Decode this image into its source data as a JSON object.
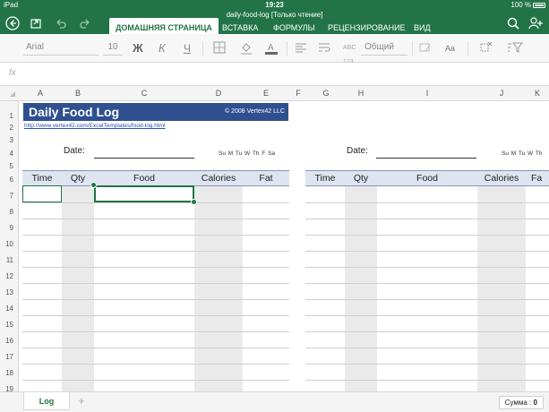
{
  "status": {
    "carrier": "iPad",
    "time": "19:23",
    "battery": "100 %"
  },
  "document": {
    "title": "daily-food-log [Только чтение]"
  },
  "toolbar": {
    "back_icon": "back-circle-icon",
    "share_icon": "share-icon",
    "undo_icon": "undo-icon",
    "redo_icon": "redo-icon",
    "search_icon": "search-icon",
    "user_icon": "add-user-icon"
  },
  "tabs": [
    "ДОМАШНЯЯ СТРАНИЦА",
    "ВСТАВКА",
    "ФОРМУЛЫ",
    "РЕЦЕНЗИРОВАНИЕ",
    "ВИД"
  ],
  "ribbon": {
    "font": "Arial",
    "size": "10",
    "bold": "Ж",
    "italic": "К",
    "underline": "Ч",
    "number_format": "Общий",
    "wrap_label": "Aa",
    "accent": "#227447"
  },
  "formula_bar": {
    "fx": "fx",
    "value": ""
  },
  "columns": [
    "A",
    "B",
    "C",
    "D",
    "E",
    "F",
    "G",
    "H",
    "I",
    "J",
    "K"
  ],
  "rows": [
    "1",
    "2",
    "3",
    "4",
    "5",
    "6",
    "7",
    "8",
    "9",
    "10",
    "11",
    "12",
    "13",
    "14",
    "15",
    "16",
    "17",
    "18",
    "19"
  ],
  "sheet": {
    "title": "Daily Food Log",
    "copyright": "© 2008 Vertex42 LLC",
    "link": "http://www.vertex42.com/ExcelTemplates/food-log.html",
    "date_label": "Date:",
    "days_left": "Su M Tu W Th F Sa",
    "days_right": "Su M Tu W Th",
    "headers_left": [
      "Time",
      "Qty",
      "Food",
      "Calories",
      "Fat"
    ],
    "headers_right": [
      "Time",
      "Qty",
      "Food",
      "Calories",
      "Fa"
    ]
  },
  "bottom": {
    "sheet_tab": "Log",
    "add": "+",
    "sum_label": "Сумма :",
    "sum_value": "0"
  }
}
